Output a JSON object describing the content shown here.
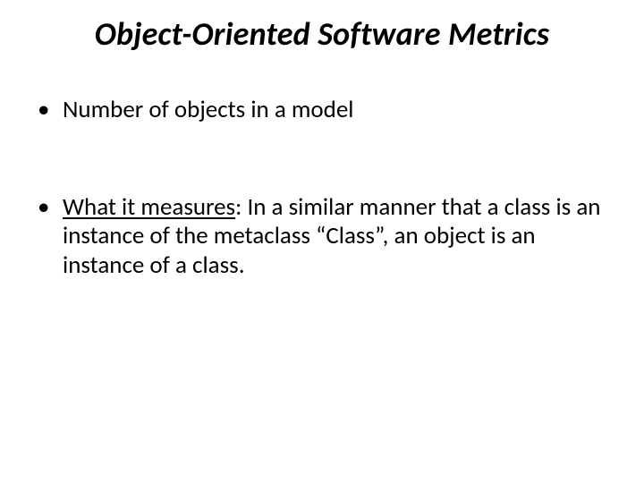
{
  "slide": {
    "title": "Object-Oriented Software Metrics",
    "bullet1": {
      "text": "Number of objects in a model"
    },
    "bullet2": {
      "label": "What it measures",
      "separator": ": ",
      "text": "In a similar manner that a class is an instance of the metaclass “Class”, an object is an instance of a class."
    }
  }
}
